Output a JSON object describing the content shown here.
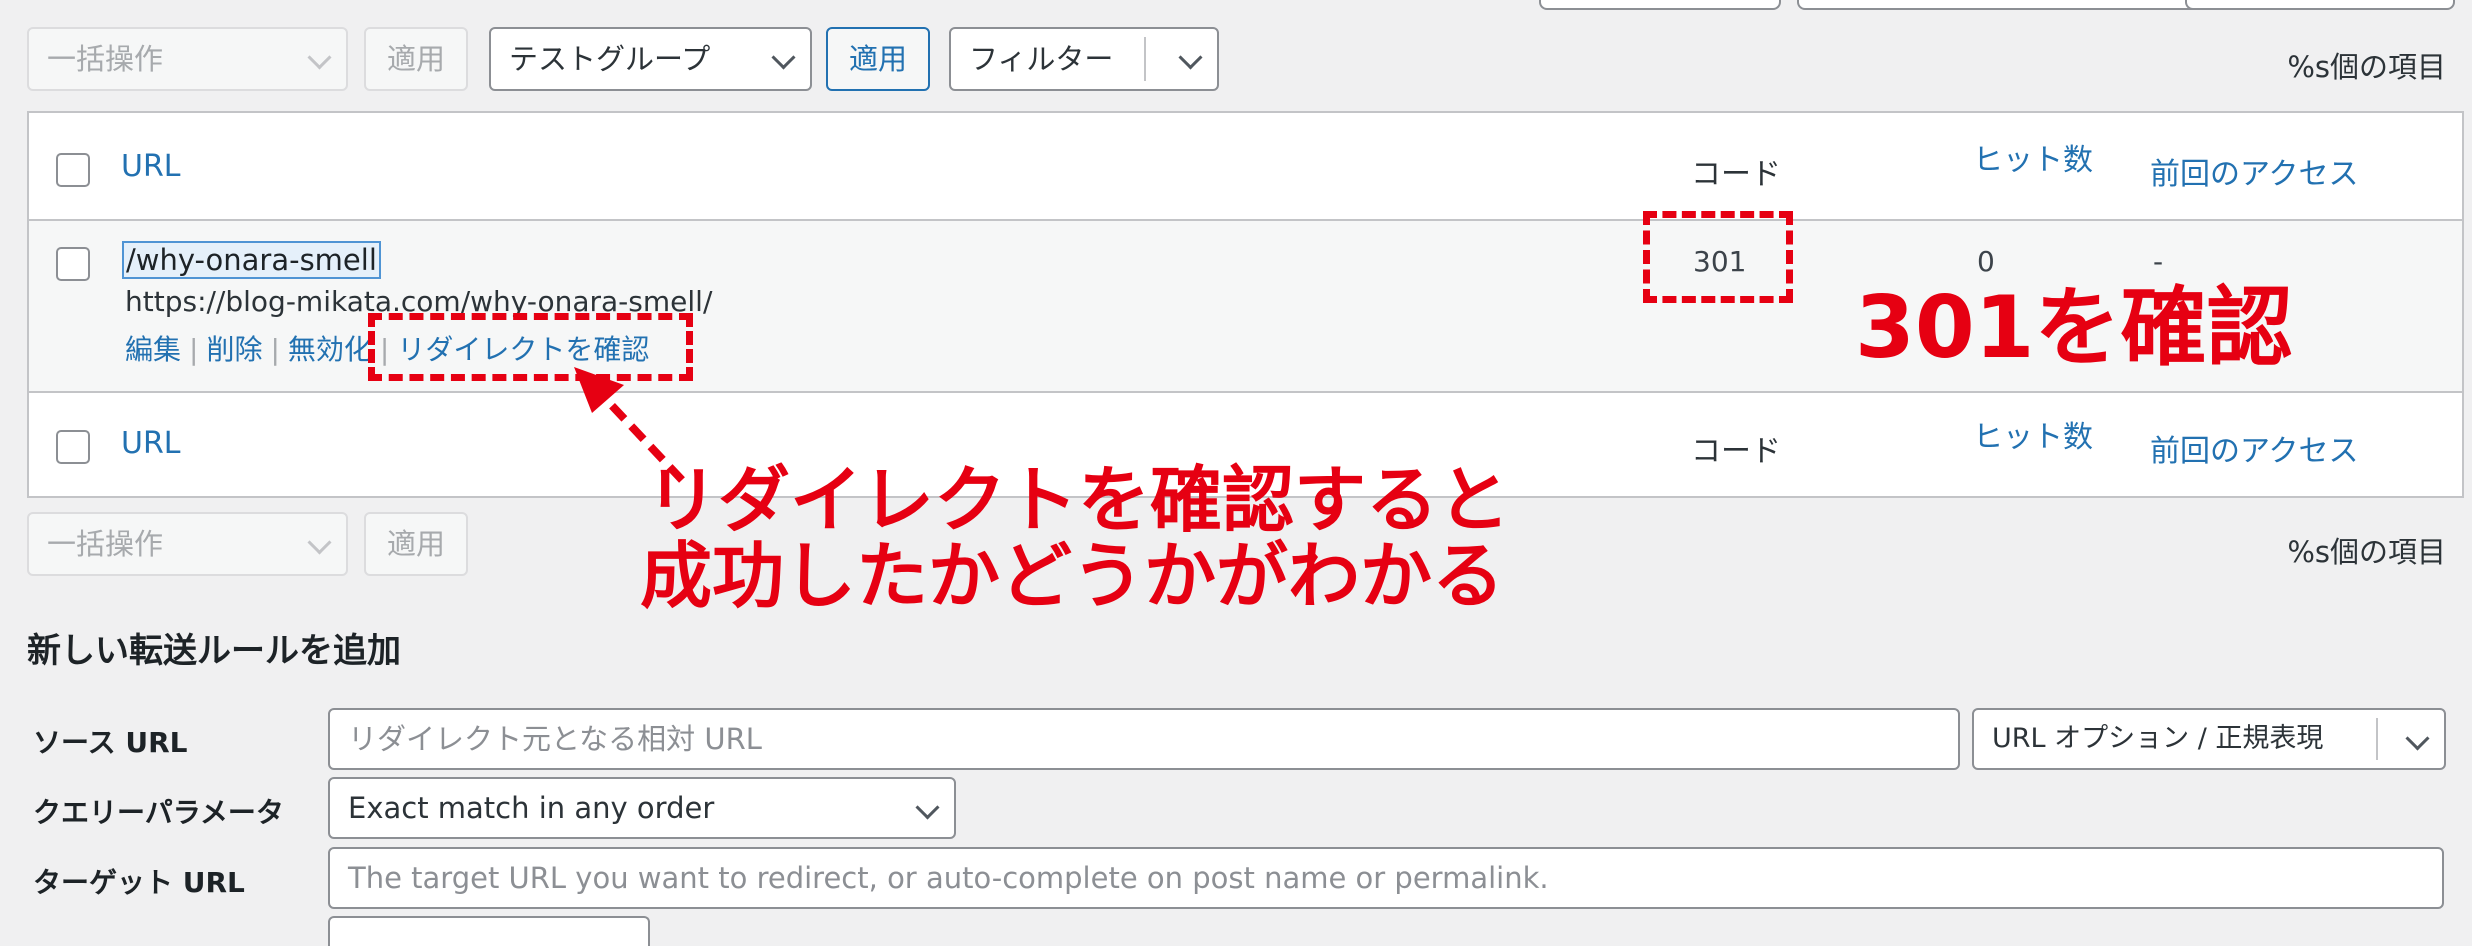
{
  "colors": {
    "accent": "#2271b1",
    "annotation": "#e60012",
    "background": "#f0f0f1"
  },
  "toolbar_top": {
    "bulk_action": "一括操作",
    "apply_disabled": "適用",
    "group_select": "テストグループ",
    "apply": "適用",
    "filter": "フィルター",
    "item_count": "%s個の項目"
  },
  "table": {
    "columns": {
      "url": "URL",
      "code": "コード",
      "hits": "ヒット数",
      "last_access": "前回のアクセス"
    },
    "rows": [
      {
        "source": "/why-onara-smell",
        "target": "https://blog-mikata.com/why-onara-smell/",
        "code": "301",
        "hits": "0",
        "last_access": "-",
        "actions": {
          "edit": "編集",
          "delete": "削除",
          "disable": "無効化",
          "check": "リダイレクトを確認"
        }
      }
    ]
  },
  "toolbar_bottom": {
    "bulk_action": "一括操作",
    "apply_disabled": "適用",
    "item_count": "%s個の項目"
  },
  "annotations": {
    "confirm_301": "301を確認",
    "explain_line1": "リダイレクトを確認すると",
    "explain_line2": "成功したかどうかがわかる"
  },
  "form": {
    "title": "新しい転送ルールを追加",
    "source_label": "ソース URL",
    "source_placeholder": "リダイレクト元となる相対 URL",
    "url_options": "URL オプション / 正規表現",
    "query_label": "クエリーパラメータ",
    "query_value": "Exact match in any order",
    "target_label": "ターゲット URL",
    "target_placeholder": "The target URL you want to redirect, or auto-complete on post name or permalink."
  }
}
